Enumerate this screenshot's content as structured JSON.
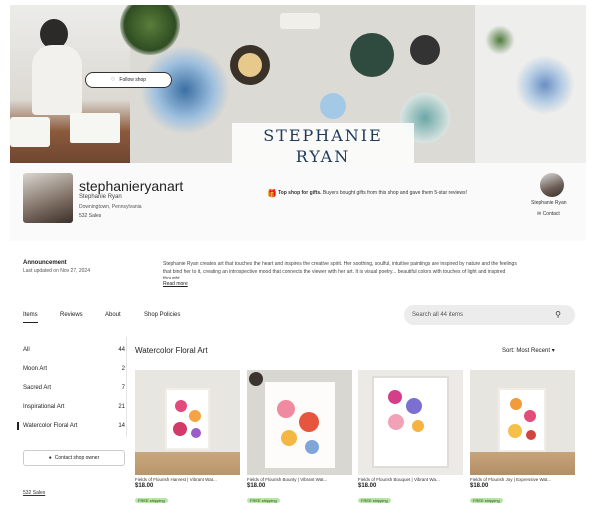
{
  "banner": {
    "title_line1": "STEPHANIE",
    "title_line2": "RYAN"
  },
  "shop": {
    "name": "stephanieryanart",
    "owner": "Stephanie Ryan",
    "location": "Downingtown, Pennsylvania",
    "sales": "532 Sales",
    "follow_label": "Follow shop",
    "gift_bold": "Top shop for gifts.",
    "gift_text": " Buyers bought gifts from this shop and gave them 5-star reviews!",
    "owner_name": "Stephanie Ryan",
    "contact_label": "Contact"
  },
  "announcement": {
    "title": "Announcement",
    "date": "Last updated on Nov 27, 2024",
    "text": "Stephanie Ryan creates art that touches the heart and inspires the creative spirit. Her soothing, soulful, intuitive paintings are inspired by nature and the feelings that bind her to it, creating an introspective mood that connects the viewer with her art. It is visual poetry... beautiful colors with touches of light and inspired thought.",
    "read_more": "Read more"
  },
  "tabs": [
    "Items",
    "Reviews",
    "About",
    "Shop Policies"
  ],
  "search": {
    "placeholder": "Search all 44 items"
  },
  "categories": [
    {
      "label": "All",
      "count": "44"
    },
    {
      "label": "Moon Art",
      "count": "2"
    },
    {
      "label": "Sacred Art",
      "count": "7"
    },
    {
      "label": "Inspirational Art",
      "count": "21"
    },
    {
      "label": "Watercolor Floral Art",
      "count": "14"
    }
  ],
  "contact_owner": "Contact shop owner",
  "sales_link": "532 Sales",
  "section_title": "Watercolor Floral Art",
  "sort_label": "Sort: Most Recent",
  "products": [
    {
      "name": "Fields of Flourish Harvest | Vibrant Wat...",
      "price": "$18.00",
      "shipping": "FREE shipping"
    },
    {
      "name": "Fields of Flourish Bounty | Vibrant Wat...",
      "price": "$18.00",
      "shipping": "FREE shipping"
    },
    {
      "name": "Fields of Flourish Bouquet | Vibrant Wa...",
      "price": "$18.00",
      "shipping": "FREE shipping"
    },
    {
      "name": "Fields of Flourish Joy | Expressive Wat...",
      "price": "$18.00",
      "shipping": "FREE shipping"
    }
  ],
  "colors": {
    "banner_title": "#1d3a5a",
    "free_shipping_bg": "#b9e6a6"
  }
}
